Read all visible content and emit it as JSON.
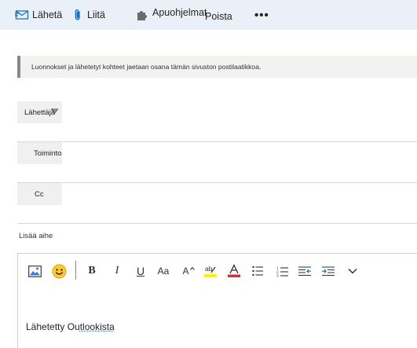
{
  "toolbar": {
    "send_label": "Lähetä",
    "attach_label": "Liitä",
    "addins_label": "Apuohjelmat",
    "delete_label": "Poista",
    "more_label": "•••"
  },
  "infobar": {
    "text": "Luonnokset ja lähetetyt kohteet jaetaan osana tämän sivuston postilaatikkoa."
  },
  "fields": {
    "from_label": "Lähettäjä",
    "to_label": "Toiminto",
    "cc_label": "Cc"
  },
  "subject": {
    "placeholder": "Lisää aihe"
  },
  "format_toolbar": {
    "bold": "B",
    "italic": "I",
    "underline": "U",
    "font_size": "Aa",
    "grow_font": "A"
  },
  "body": {
    "signature_prefix": "Lähetetty Ou",
    "signature_link": "tlookista"
  },
  "colors": {
    "accent": "#0f6cbd",
    "toolbar_bg": "#e9f0f8",
    "highlight": "#fff100",
    "font_color": "#d13438"
  }
}
